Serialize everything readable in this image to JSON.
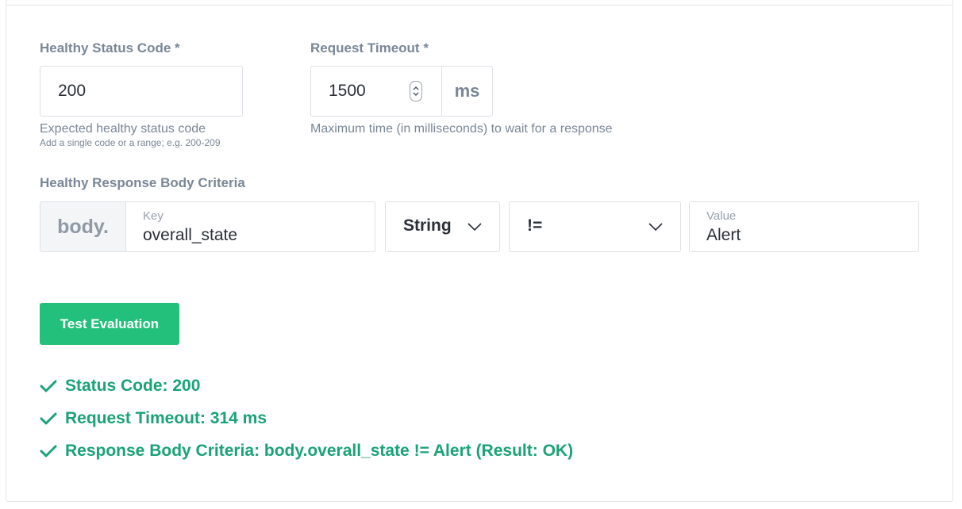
{
  "form": {
    "status_code": {
      "label": "Healthy Status Code *",
      "value": "200",
      "help": "Expected healthy status code",
      "help_small": "Add a single code or a range; e.g. 200-209"
    },
    "timeout": {
      "label": "Request Timeout *",
      "value": "1500",
      "unit": "ms",
      "help": "Maximum time (in milliseconds) to wait for a response"
    },
    "criteria": {
      "label": "Healthy Response Body Criteria",
      "prefix": "body.",
      "key_label": "Key",
      "key_value": "overall_state",
      "type_value": "String",
      "operator_value": "!=",
      "value_label": "Value",
      "value_value": "Alert"
    }
  },
  "actions": {
    "test_label": "Test Evaluation"
  },
  "results": [
    "Status Code: 200",
    "Request Timeout: 314 ms",
    "Response Body Criteria: body.overall_state != Alert (Result: OK)"
  ],
  "colors": {
    "accent": "#22c07a",
    "success_text": "#1aa374",
    "label": "#7a8797",
    "border": "#dde1e6"
  },
  "icons": [
    "spinner-arrows-icon",
    "chevron-down-icon",
    "checkmark-icon"
  ]
}
